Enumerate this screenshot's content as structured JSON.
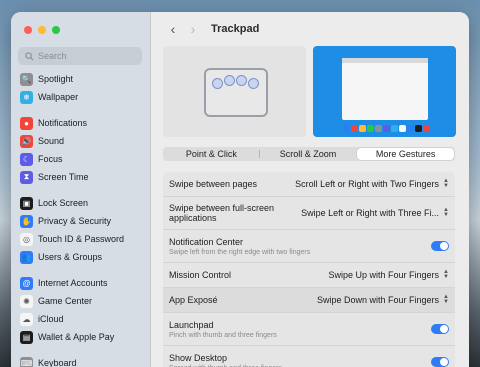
{
  "window": {
    "title": "Trackpad"
  },
  "sidebar": {
    "search_placeholder": "Search",
    "items": [
      {
        "label": "Spotlight",
        "icon": "spotlight-icon",
        "color": "#8e8e93",
        "glyph": "🔍"
      },
      {
        "label": "Wallpaper",
        "icon": "wallpaper-icon",
        "color": "#30b0e6",
        "glyph": "❄"
      },
      {
        "label": "Notifications",
        "icon": "notifications-icon",
        "color": "#f2443a",
        "glyph": "●"
      },
      {
        "label": "Sound",
        "icon": "sound-icon",
        "color": "#f2443a",
        "glyph": "🔊"
      },
      {
        "label": "Focus",
        "icon": "focus-icon",
        "color": "#5e5ce6",
        "glyph": "☾"
      },
      {
        "label": "Screen Time",
        "icon": "screen-time-icon",
        "color": "#5e5ce6",
        "glyph": "⧗"
      },
      {
        "label": "Lock Screen",
        "icon": "lock-screen-icon",
        "color": "#1c1c1e",
        "glyph": "▣"
      },
      {
        "label": "Privacy & Security",
        "icon": "privacy-icon",
        "color": "#2f7cf6",
        "glyph": "✋"
      },
      {
        "label": "Touch ID & Password",
        "icon": "touch-id-icon",
        "color": "#f5f5f5",
        "glyph": "◎"
      },
      {
        "label": "Users & Groups",
        "icon": "users-icon",
        "color": "#2f7cf6",
        "glyph": "👥"
      },
      {
        "label": "Internet Accounts",
        "icon": "internet-accounts-icon",
        "color": "#2f7cf6",
        "glyph": "@"
      },
      {
        "label": "Game Center",
        "icon": "game-center-icon",
        "color": "#f5f5f5",
        "glyph": "✺"
      },
      {
        "label": "iCloud",
        "icon": "icloud-icon",
        "color": "#f5f5f5",
        "glyph": "☁"
      },
      {
        "label": "Wallet & Apple Pay",
        "icon": "wallet-icon",
        "color": "#1c1c1e",
        "glyph": "▤"
      },
      {
        "label": "Keyboard",
        "icon": "keyboard-icon",
        "color": "#8e8e93",
        "glyph": "⌨"
      }
    ]
  },
  "tabs": [
    "Point & Click",
    "Scroll & Zoom",
    "More Gestures"
  ],
  "selected_tab": "More Gestures",
  "gestures": [
    {
      "label": "Swipe between pages",
      "value": "Scroll Left or Right with Two Fingers",
      "type": "popup"
    },
    {
      "label": "Swipe between full-screen\napplications",
      "value": "Swipe Left or Right with Three Fi...",
      "type": "popup"
    },
    {
      "label": "Notification Center",
      "sub": "Swipe left from the right edge with two fingers",
      "type": "toggle",
      "on": true
    },
    {
      "label": "Mission Control",
      "value": "Swipe Up with Four Fingers",
      "type": "popup"
    },
    {
      "label": "App Exposé",
      "value": "Swipe Down with Four Fingers",
      "type": "popup"
    },
    {
      "label": "Launchpad",
      "sub": "Pinch with thumb and three fingers",
      "type": "toggle",
      "on": true
    },
    {
      "label": "Show Desktop",
      "sub": "Spread with thumb and three fingers",
      "type": "toggle",
      "on": true
    }
  ],
  "colors": {
    "accent": "#2f7cf6",
    "close": "#ff5f57",
    "minimize": "#febc2e",
    "zoom": "#28c840"
  }
}
